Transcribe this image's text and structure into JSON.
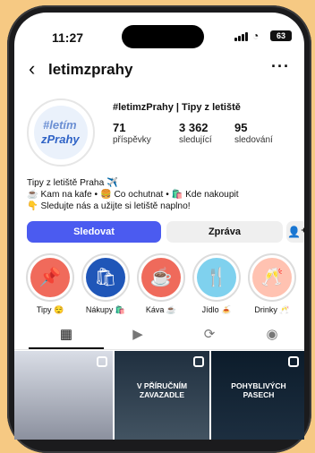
{
  "status_bar": {
    "time": "11:27",
    "battery": "63"
  },
  "profile": {
    "username": "letimzprahy",
    "name": "#letimzPrahy | Tipy z letiště",
    "avatar_text_top": "#letím",
    "avatar_text_bottom": "zPrahy",
    "stats": [
      {
        "value": "71",
        "label": "příspěvky"
      },
      {
        "value": "3 362",
        "label": "sledující"
      },
      {
        "value": "95",
        "label": "sledování"
      }
    ],
    "bio_lines": [
      "Tipy z letiště Praha ✈️",
      "☕ Kam na kafe • 🍔 Co ochutnat • 🛍️ Kde nakoupit",
      "👇 Sledujte nás a užijte si letiště naplno!"
    ]
  },
  "actions": {
    "follow_label": "Sledovat",
    "message_label": "Zpráva"
  },
  "highlights": [
    {
      "label": "Tipy 😌",
      "icon": "pin-icon",
      "color": "#f06a5b"
    },
    {
      "label": "Nákupy 🛍️",
      "icon": "bag-icon",
      "color": "#1f56b8"
    },
    {
      "label": "Káva ☕",
      "icon": "coffee-icon",
      "color": "#ef6a5b"
    },
    {
      "label": "Jídlo 🍝",
      "icon": "fork-knife-icon",
      "color": "#7fd1ee"
    },
    {
      "label": "Drinky 🥂",
      "icon": "champagne-icon",
      "color": "#ffc2b1"
    }
  ],
  "tabs": [
    {
      "name": "grid",
      "icon": "grid-icon"
    },
    {
      "name": "reels",
      "icon": "reels-icon"
    },
    {
      "name": "repost",
      "icon": "repost-icon"
    },
    {
      "name": "tagged",
      "icon": "tagged-icon"
    }
  ],
  "posts": [
    {
      "title": "",
      "style": "post1"
    },
    {
      "title": "V PŘÍRUČNÍM ZAVAZADLE",
      "style": "post2"
    },
    {
      "title": "POHYBLIVÝCH PASECH",
      "style": "post3"
    }
  ]
}
